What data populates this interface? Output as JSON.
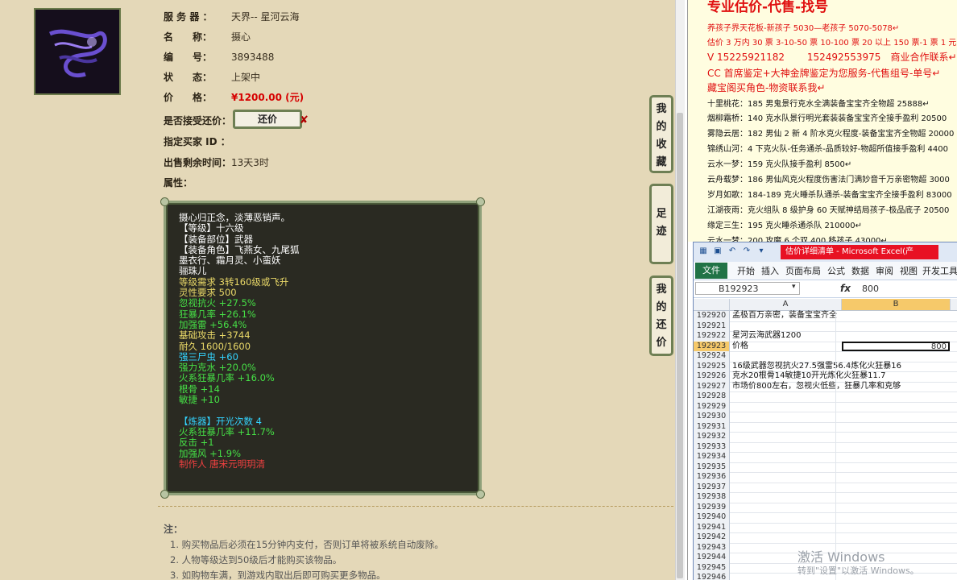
{
  "item": {
    "server_label": "服 务 器 ：",
    "server_value": "天界-- 星河云海",
    "name_label": "名　　称：",
    "name_value": "摄心",
    "id_label": "编　　号：",
    "id_value": "3893488",
    "status_label": "状　　态：",
    "status_value": "上架中",
    "price_label": "价　　格：",
    "price_value": "¥1200.00 (元)",
    "counter_label": "是否接受还价：",
    "counter_button": "还价",
    "counter_x": "✘",
    "buyer_label": "指定买家 ID ：",
    "buyer_value": "",
    "time_label": "出售剩余时间：",
    "time_value": "13天3时",
    "attr_label": "属性："
  },
  "attributes": [
    {
      "text": "摄心归正念，淡薄恶销声。",
      "color": "w"
    },
    {
      "text": "【等级】十六级",
      "color": "w"
    },
    {
      "text": "【装备部位】武器",
      "color": "w"
    },
    {
      "text": "【装备角色】飞燕女、九尾狐",
      "color": "w"
    },
    {
      "text": "墨衣行、霜月灵、小蛮妖",
      "color": "w"
    },
    {
      "text": "骊珠儿",
      "color": "w"
    },
    {
      "text": "等级需求 3转160级或飞升",
      "color": "y"
    },
    {
      "text": "灵性要求 500",
      "color": "y"
    },
    {
      "text": "忽视抗火 +27.5%",
      "color": "g"
    },
    {
      "text": "狂暴几率 +26.1%",
      "color": "g"
    },
    {
      "text": "加强雷 +56.4%",
      "color": "g"
    },
    {
      "text": "基础攻击 +3744",
      "color": "y"
    },
    {
      "text": "耐久 1600/1600",
      "color": "y"
    },
    {
      "text": "强三尸虫 +60",
      "color": "c"
    },
    {
      "text": "强力克水 +20.0%",
      "color": "g"
    },
    {
      "text": "火系狂暴几率 +16.0%",
      "color": "g"
    },
    {
      "text": "根骨 +14",
      "color": "g"
    },
    {
      "text": "敏捷 +10",
      "color": "g"
    },
    {
      "text": "",
      "color": "w"
    },
    {
      "text": "【炼器】开光次数 4",
      "color": "c"
    },
    {
      "text": "火系狂暴几率 +11.7%",
      "color": "g"
    },
    {
      "text": "反击 +1",
      "color": "g"
    },
    {
      "text": "加强风 +1.9%",
      "color": "g"
    },
    {
      "text": "制作人 唐宋元明玥清",
      "color": "r"
    }
  ],
  "side_tabs": {
    "favorites": "我的收藏",
    "footprint": "足迹",
    "my_counter": "我的还价"
  },
  "notes": {
    "title": "注：",
    "items": [
      "1. 购买物品后必须在15分钟内支付，否则订单将被系统自动废除。",
      "2. 人物等级达到50级后才能购买该物品。",
      "3. 如购物车满，到游戏内取出后即可购买更多物品。"
    ]
  },
  "notepad": {
    "title": "专业估价-代售-找号",
    "lines": [
      {
        "text": "养孩子界天花板-新孩子 5030—老孩子 5070-5078↵",
        "red": true,
        "big": false
      },
      {
        "text": "估价 3 万内 30 票 3-10-50 票 10-100 票 20 以上 150 票-1 票 1 元",
        "red": true,
        "big": false
      },
      {
        "text": "V 15225921182　　 152492553975　商业合作联系↵",
        "red": true,
        "big": true
      },
      {
        "text": "CC 首席鉴定+大神金牌鉴定为您服务-代售组号-单号↵",
        "red": true,
        "big": true
      },
      {
        "text": "藏宝阁买角色-物资联系我↵",
        "red": true,
        "big": true
      },
      {
        "text": "十里桃花：185 男鬼景行克水全满装备宝宝齐全物超 25888↵",
        "red": false,
        "big": false
      },
      {
        "text": "烟柳霜桥：140 克水队景行明光套装装备宝宝齐全接手盈利 20500",
        "red": false,
        "big": false
      },
      {
        "text": "雾隐云居：182 男仙 2 新 4 阶水克火程度-装备宝宝齐全物超 20000",
        "red": false,
        "big": false
      },
      {
        "text": "锦绣山河：4 下克火队-任务通杀-品质较好-物超所值接手盈利 4400",
        "red": false,
        "big": false
      },
      {
        "text": "云水一梦：159 克火队接手盈利 8500↵",
        "red": false,
        "big": false
      },
      {
        "text": "云舟载梦：186 男仙风克火程度伤害法门满妙音千万亲密物超 3000",
        "red": false,
        "big": false
      },
      {
        "text": "岁月如歌：184-189 克火睡杀队通杀-装备宝宝齐全接手盈利 83000",
        "red": false,
        "big": false
      },
      {
        "text": "江湖夜雨：克火组队 8 级护身 60 天赋神结局孩子-极品底子 20500",
        "red": false,
        "big": false
      },
      {
        "text": "缘定三生：195 克火睡杀通杀队 210000↵",
        "red": false,
        "big": false
      },
      {
        "text": "云水一梦：200 攻魔 6 个双 400 移孩子 43000↵",
        "red": false,
        "big": false
      }
    ]
  },
  "excel": {
    "title": "估价详细清单 - Microsoft Excel(产",
    "file_tab": "文件",
    "tabs": [
      "开始",
      "插入",
      "页面布局",
      "公式",
      "数据",
      "审阅",
      "视图",
      "开发工具"
    ],
    "namebox": "B192923",
    "fx": "fx",
    "formula_value": "800",
    "col_a": "A",
    "col_b": "B",
    "selected_value": "800",
    "rows": [
      {
        "num": "192920",
        "a": "孟极百万亲密，装备宝宝齐全"
      },
      {
        "num": "192921",
        "a": ""
      },
      {
        "num": "192922",
        "a": "星河云海武器1200"
      },
      {
        "num": "192923",
        "a": "价格",
        "selected": true
      },
      {
        "num": "192924",
        "a": ""
      },
      {
        "num": "192925",
        "a": "16级武器忽视抗火27.5强雷56.4炼化火狂暴16"
      },
      {
        "num": "192926",
        "a": "克水20根骨14敏捷10开光炼化火狂暴11.7"
      },
      {
        "num": "192927",
        "a": "市场价800左右，忽视火低些，狂暴几率和克够"
      },
      {
        "num": "192928",
        "a": ""
      },
      {
        "num": "192929",
        "a": ""
      },
      {
        "num": "192930",
        "a": ""
      },
      {
        "num": "192931",
        "a": ""
      },
      {
        "num": "192932",
        "a": ""
      },
      {
        "num": "192933",
        "a": ""
      },
      {
        "num": "192934",
        "a": ""
      },
      {
        "num": "192935",
        "a": ""
      },
      {
        "num": "192936",
        "a": ""
      },
      {
        "num": "192937",
        "a": ""
      },
      {
        "num": "192938",
        "a": ""
      },
      {
        "num": "192939",
        "a": ""
      },
      {
        "num": "192940",
        "a": ""
      },
      {
        "num": "192941",
        "a": ""
      },
      {
        "num": "192942",
        "a": ""
      },
      {
        "num": "192943",
        "a": ""
      },
      {
        "num": "192944",
        "a": ""
      },
      {
        "num": "192945",
        "a": ""
      },
      {
        "num": "192946",
        "a": ""
      }
    ]
  },
  "watermark": {
    "line1": "激活 Windows",
    "line2": "转到\"设置\"以激活 Windows。"
  },
  "colors": {
    "price_red": "#d60000",
    "excel_green": "#217346",
    "title_red": "#e81123"
  }
}
